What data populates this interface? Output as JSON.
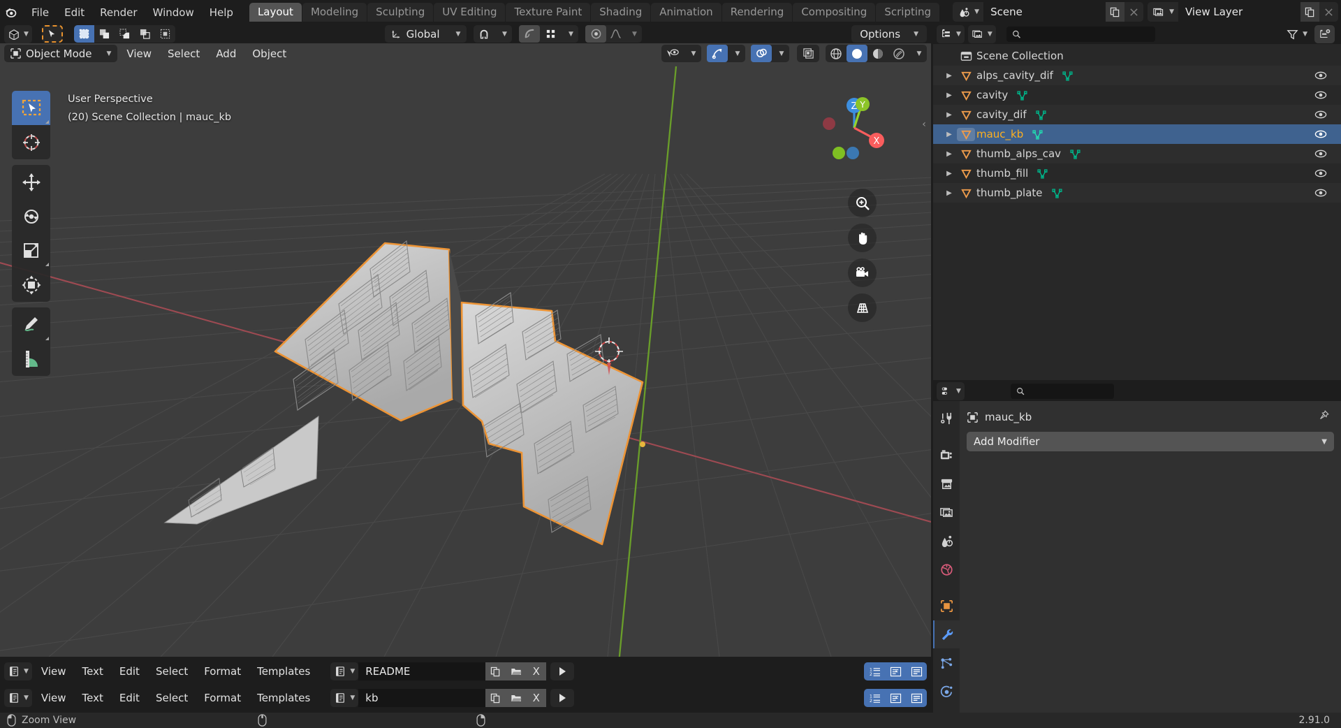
{
  "app": {
    "version": "2.91.0"
  },
  "topbar": {
    "logo_icon": "blender-logo-icon",
    "menus": [
      "File",
      "Edit",
      "Render",
      "Window",
      "Help"
    ],
    "workspaces": [
      "Layout",
      "Modeling",
      "Sculpting",
      "UV Editing",
      "Texture Paint",
      "Shading",
      "Animation",
      "Rendering",
      "Compositing",
      "Scripting"
    ],
    "active_workspace": "Layout",
    "scene": {
      "icon": "scene-icon",
      "name": "Scene",
      "copy_icon": "duplicate-icon",
      "close_icon": "x-icon"
    },
    "view_layer": {
      "icon": "view-layer-icon",
      "name": "View Layer",
      "copy_icon": "duplicate-icon",
      "close_icon": "x-icon"
    }
  },
  "viewport": {
    "header": {
      "editor_type_icon": "editor-type-3dview-icon",
      "cursor_tool_icon": "select-box-icon",
      "select_modes": [
        "select-new-icon",
        "select-extend-icon",
        "select-subtract-icon",
        "select-difference-icon",
        "select-intersect-icon"
      ],
      "transform_orientation": "Global",
      "orientation_icon": "orientation-gizmo-icon",
      "snap_icon": "magnet-icon",
      "snap_target_icon": "snap-grid-icon",
      "proportional_icon": "proportional-edit-icon",
      "falloff_icon": "falloff-curve-icon",
      "options_label": "Options",
      "visibility_icon": "show-hide-icon",
      "gizmo_icon": "gizmo-icon",
      "overlays_icon": "overlays-icon",
      "xray_icon": "xray-icon",
      "shading_modes": [
        "wireframe-icon",
        "solid-icon",
        "material-preview-icon",
        "rendered-icon"
      ],
      "active_shading": "solid-icon"
    },
    "header2": {
      "mode": "Object Mode",
      "mode_icon": "object-mode-icon",
      "menus": [
        "View",
        "Select",
        "Add",
        "Object"
      ]
    },
    "overlay_line1": "User Perspective",
    "overlay_line2": "(20) Scene Collection | mauc_kb",
    "toolbar": [
      {
        "icon": "tweak-select-box-icon",
        "active": true
      },
      {
        "icon": "cursor-3d-icon",
        "active": false
      },
      {
        "icon": "move-icon",
        "active": false
      },
      {
        "icon": "rotate-icon",
        "active": false
      },
      {
        "icon": "scale-icon",
        "active": false
      },
      {
        "icon": "transform-icon",
        "active": false
      },
      {
        "icon": "annotate-icon",
        "active": false
      },
      {
        "icon": "measure-icon",
        "active": false
      }
    ],
    "gizmo": {
      "axes": [
        "X",
        "Y",
        "Z"
      ],
      "colors": {
        "x": "#fa5d5d",
        "y": "#96d42a",
        "z": "#3d8fe0"
      }
    },
    "nav_buttons": [
      "zoom-icon",
      "pan-hand-icon",
      "camera-view-icon",
      "toggle-perspective-icon"
    ],
    "sidebar_toggle_icon": "chevron-left-icon"
  },
  "outliner": {
    "header": {
      "editor_type_icon": "editor-type-outliner-icon",
      "display_mode_icon": "view-layer-icon",
      "search_placeholder": "",
      "search_icon": "search-icon",
      "filter_icon": "filter-funnel-icon",
      "new_collection_icon": "new-collection-icon"
    },
    "root": {
      "label": "Scene Collection",
      "icon": "collection-icon"
    },
    "items": [
      {
        "label": "alps_cavity_dif",
        "icon": "mesh-object-icon",
        "data_icon": "mesh-data-icon",
        "visible_icon": "eye-open-icon",
        "selected": false
      },
      {
        "label": "cavity",
        "icon": "mesh-object-icon",
        "data_icon": "mesh-data-icon",
        "visible_icon": "eye-open-icon",
        "selected": false
      },
      {
        "label": "cavity_dif",
        "icon": "mesh-object-icon",
        "data_icon": "mesh-data-icon",
        "visible_icon": "eye-open-icon",
        "selected": false
      },
      {
        "label": "mauc_kb",
        "icon": "mesh-object-icon",
        "data_icon": "mesh-data-icon",
        "visible_icon": "eye-open-icon",
        "selected": true
      },
      {
        "label": "thumb_alps_cav",
        "icon": "mesh-object-icon",
        "data_icon": "mesh-data-icon",
        "visible_icon": "eye-open-icon",
        "selected": false
      },
      {
        "label": "thumb_fill",
        "icon": "mesh-object-icon",
        "data_icon": "mesh-data-icon",
        "visible_icon": "eye-open-icon",
        "selected": false
      },
      {
        "label": "thumb_plate",
        "icon": "mesh-object-icon",
        "data_icon": "mesh-data-icon",
        "visible_icon": "eye-open-icon",
        "selected": false
      }
    ]
  },
  "properties": {
    "header": {
      "editor_type_icon": "editor-type-properties-icon",
      "search_icon": "search-icon",
      "search_placeholder": ""
    },
    "tabs": [
      {
        "icon": "tool-icon",
        "active": false
      },
      {
        "icon": "render-icon",
        "active": false
      },
      {
        "icon": "output-icon",
        "active": false
      },
      {
        "icon": "view-layer-icon",
        "active": false
      },
      {
        "icon": "scene-icon",
        "active": false
      },
      {
        "icon": "world-icon",
        "active": false
      },
      {
        "icon": "object-icon",
        "active": false
      },
      {
        "icon": "modifier-wrench-icon",
        "active": true
      },
      {
        "icon": "particles-icon",
        "active": false
      },
      {
        "icon": "physics-icon",
        "active": false
      }
    ],
    "breadcrumb": {
      "icon": "object-icon",
      "label": "mauc_kb",
      "pin_icon": "pin-icon"
    },
    "add_modifier_label": "Add Modifier",
    "add_modifier_chevron": "chevron-down-icon"
  },
  "text_editors": [
    {
      "editor_type_icon": "editor-type-text-icon",
      "menus": [
        "View",
        "Text",
        "Edit",
        "Select",
        "Format",
        "Templates"
      ],
      "datablock_icon": "text-datablock-icon",
      "name": "README",
      "copy_icon": "duplicate-icon",
      "open_icon": "folder-open-icon",
      "unlink_label": "X",
      "run_icon": "play-run-script-icon",
      "toggles": [
        "line-numbers-icon",
        "word-wrap-icon",
        "syntax-highlight-icon"
      ]
    },
    {
      "editor_type_icon": "editor-type-text-icon",
      "menus": [
        "View",
        "Text",
        "Edit",
        "Select",
        "Format",
        "Templates"
      ],
      "datablock_icon": "text-datablock-icon",
      "name": "kb",
      "copy_icon": "duplicate-icon",
      "open_icon": "folder-open-icon",
      "unlink_label": "X",
      "run_icon": "play-run-script-icon",
      "toggles": [
        "line-numbers-icon",
        "word-wrap-icon",
        "syntax-highlight-icon"
      ]
    }
  ],
  "statusbar": {
    "mouse_icon": "mouse-left-icon",
    "hint": "Zoom View",
    "mouse_middle_icon": "mouse-middle-icon",
    "mouse_right_icon": "mouse-right-icon",
    "version": "2.91.0"
  },
  "colors": {
    "accent_blue": "#4772b3",
    "selected_text": "#ffb01f",
    "mesh_object": "#ed9b4b",
    "mesh_data": "#00b389",
    "axis_x": "#fa5d5d",
    "axis_y": "#96d42a",
    "axis_z": "#3d8fe0",
    "outline_select": "#ed9435"
  }
}
